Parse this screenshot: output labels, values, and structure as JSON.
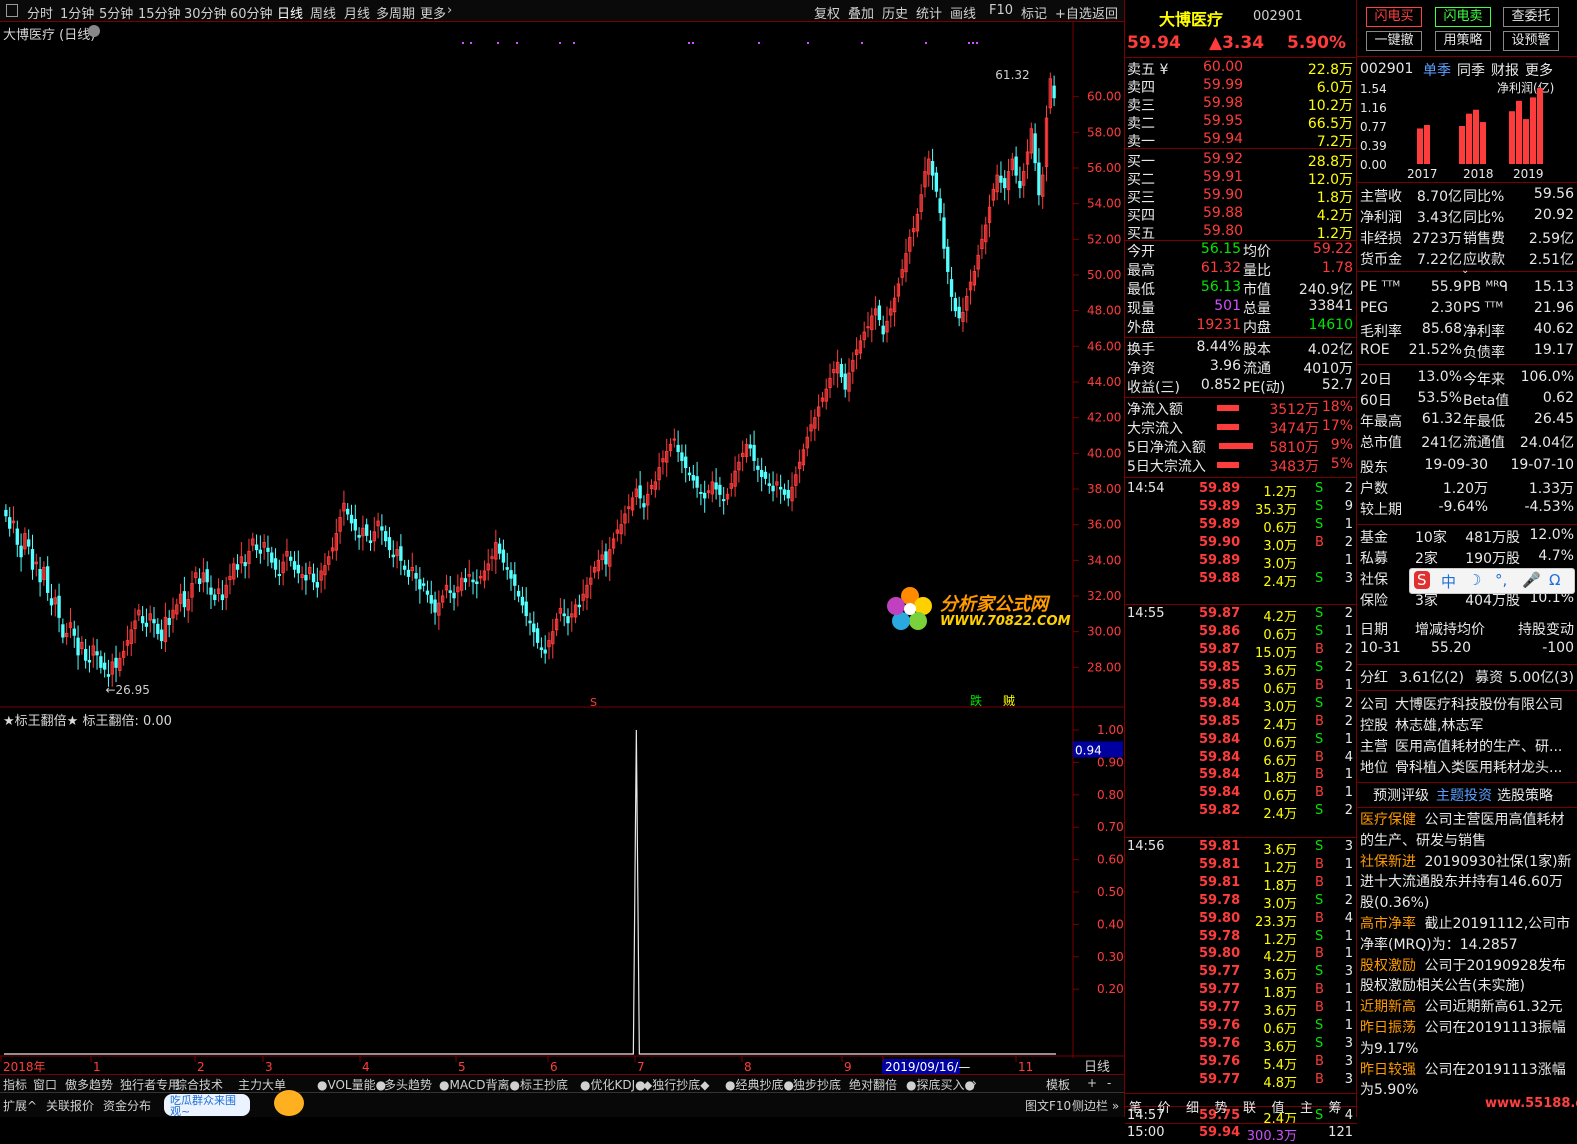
{
  "toolbar": {
    "periods": [
      "分时",
      "1分钟",
      "5分钟",
      "15分钟",
      "30分钟",
      "60分钟",
      "日线",
      "周线",
      "月线",
      "多周期",
      "更多"
    ],
    "tools": [
      "复权",
      "叠加",
      "历史",
      "统计",
      "画线",
      "F10",
      "标记",
      "+自选",
      "返回"
    ]
  },
  "chart_title": "大博医疗 (日线)",
  "indicator_title": "★标王翻倍★ 标王翻倍: 0.00",
  "chart_data": [
    {
      "type": "candlestick",
      "ylim": [
        26,
        62
      ],
      "yticks": [
        "60.00",
        "58.00",
        "56.00",
        "54.00",
        "52.00",
        "50.00",
        "48.00",
        "46.00",
        "44.00",
        "42.00",
        "40.00",
        "38.00",
        "36.00",
        "34.00",
        "32.00",
        "30.00",
        "28.00"
      ],
      "x_labels": [
        "2018年",
        "1",
        "2",
        "3",
        "4",
        "5",
        "6",
        "7",
        "8",
        "9",
        "2019/09/16/—",
        "11"
      ],
      "annotations": {
        "high": "61.32",
        "low": "26.95"
      },
      "closes": [
        36.5,
        35.8,
        36.2,
        34.9,
        34.2,
        35.5,
        34.8,
        33.5,
        33.9,
        32.8,
        33.6,
        32.2,
        31.5,
        31.9,
        30.8,
        29.7,
        29.9,
        30.5,
        29.8,
        28.7,
        29.4,
        28.4,
        28.3,
        29.2,
        28.7,
        28.0,
        27.9,
        27.5,
        28.3,
        28.0,
        28.5,
        28.9,
        29.5,
        30.1,
        30.6,
        31.2,
        30.5,
        30.3,
        31.0,
        30.5,
        29.9,
        29.5,
        30.8,
        30.4,
        31.2,
        31.5,
        32.1,
        31.4,
        31.8,
        32.7,
        33.3,
        32.7,
        33.3,
        32.8,
        32.1,
        31.8,
        32.4,
        31.8,
        32.6,
        33.1,
        33.8,
        33.5,
        34.2,
        33.7,
        34.5,
        35.2,
        34.6,
        34.4,
        35.0,
        34.5,
        33.9,
        33.5,
        33.2,
        33.9,
        34.5,
        34.0,
        33.5,
        33.3,
        33.2,
        32.9,
        33.6,
        32.8,
        32.5,
        33.4,
        33.7,
        34.2,
        34.7,
        35.5,
        36.4,
        37.2,
        36.6,
        36.1,
        35.7,
        35.3,
        35.8,
        35.4,
        35.0,
        35.6,
        36.2,
        35.7,
        35.1,
        34.6,
        34.2,
        34.6,
        34.0,
        33.5,
        33.1,
        33.6,
        33.0,
        32.4,
        32.6,
        32.1,
        31.6,
        31.1,
        31.6,
        32.0,
        32.6,
        32.2,
        31.9,
        32.5,
        33.0,
        32.8,
        33.2,
        32.8,
        32.7,
        33.1,
        33.4,
        33.8,
        34.2,
        35.0,
        34.4,
        33.9,
        33.5,
        33.0,
        32.6,
        32.0,
        31.5,
        30.9,
        30.5,
        30.0,
        29.4,
        29.0,
        28.8,
        29.5,
        30.0,
        30.7,
        31.3,
        30.9,
        30.5,
        31.0,
        31.5,
        31.4,
        32.1,
        32.6,
        33.0,
        33.6,
        34.0,
        34.3,
        33.8,
        34.6,
        35.2,
        35.7,
        36.0,
        36.6,
        37.0,
        37.5,
        38.0,
        37.5,
        37.0,
        37.7,
        38.2,
        38.4,
        39.2,
        39.7,
        40.1,
        40.5,
        40.8,
        40.1,
        39.6,
        39.2,
        38.8,
        38.5,
        38.1,
        37.8,
        37.5,
        37.9,
        38.4,
        38.0,
        37.7,
        37.4,
        37.7,
        38.3,
        39.0,
        39.5,
        40.0,
        40.5,
        40.3,
        39.6,
        39.1,
        38.7,
        38.6,
        38.2,
        37.9,
        38.4,
        38.0,
        37.7,
        37.5,
        38.1,
        38.8,
        39.5,
        40.2,
        40.9,
        41.6,
        42.0,
        42.6,
        43.1,
        43.6,
        44.2,
        44.7,
        45.1,
        44.3,
        43.6,
        44.5,
        45.2,
        45.8,
        46.3,
        46.8,
        47.1,
        47.7,
        48.1,
        47.5,
        46.7,
        47.4,
        48.1,
        48.7,
        49.5,
        50.3,
        51.2,
        52.1,
        52.6,
        53.4,
        54.5,
        55.8,
        56.5,
        55.6,
        54.7,
        53.5,
        51.5,
        50.2,
        48.8,
        48.0,
        47.6,
        47.9,
        48.8,
        49.6,
        50.2,
        51.1,
        52.0,
        52.8,
        53.8,
        54.8,
        55.6,
        55.2,
        54.9,
        55.8,
        56.5,
        55.6,
        54.9,
        55.8,
        56.9,
        58.2,
        56.3,
        54.5,
        55.6,
        58.8,
        61.0,
        59.94
      ]
    },
    {
      "type": "line",
      "title": "★标王翻倍★",
      "ylim": [
        0,
        1
      ],
      "yticks": [
        "1.00",
        "0.90",
        "0.80",
        "0.70",
        "0.60",
        "0.50",
        "0.40",
        "0.30",
        "0.20"
      ],
      "current": "0.94",
      "signals": [
        0,
        0,
        0,
        0,
        0,
        0,
        0,
        0,
        0,
        0,
        1,
        0,
        0,
        0,
        0,
        0,
        0,
        0,
        0,
        0,
        0,
        0,
        0,
        0,
        0,
        0,
        0,
        0,
        0,
        0,
        0,
        0,
        0,
        0,
        0,
        0,
        0,
        0,
        0,
        0,
        0,
        0,
        0,
        0,
        0,
        0,
        0,
        0,
        0,
        0
      ],
      "signal_index": 166
    }
  ],
  "chart_marks": [
    "S",
    "跌",
    "贼"
  ],
  "watermark": {
    "line1": "分析家公式网",
    "line2": "WWW.70822.COM"
  },
  "quote": {
    "name": "大博医疗",
    "code": "002901",
    "price": "59.94",
    "change": "▲3.34",
    "pct": "5.90%",
    "asks": [
      [
        "卖五 ¥",
        "60.00",
        "22.8万"
      ],
      [
        "卖四",
        "59.99",
        "6.0万"
      ],
      [
        "卖三",
        "59.98",
        "10.2万"
      ],
      [
        "卖二",
        "59.95",
        "66.5万"
      ],
      [
        "卖一",
        "59.94",
        "7.2万"
      ]
    ],
    "bids": [
      [
        "买一",
        "59.92",
        "28.8万"
      ],
      [
        "买二",
        "59.91",
        "12.0万"
      ],
      [
        "买三",
        "59.90",
        "1.8万"
      ],
      [
        "买四",
        "59.88",
        "4.2万"
      ],
      [
        "买五",
        "59.80",
        "1.2万"
      ]
    ],
    "stats": [
      [
        "今开",
        "56.15",
        "均价",
        "59.22"
      ],
      [
        "最高",
        "61.32",
        "量比",
        "1.78"
      ],
      [
        "最低",
        "56.13",
        "市值",
        "240.9亿"
      ],
      [
        "现量",
        "501",
        "总量",
        "33841"
      ],
      [
        "外盘",
        "19231",
        "内盘",
        "14610"
      ]
    ],
    "stats2": [
      [
        "换手",
        "8.44%",
        "股本",
        "4.02亿"
      ],
      [
        "净资",
        "3.96",
        "流通",
        "4010万"
      ],
      [
        "收益(三)",
        "0.852",
        "PE(动)",
        "52.7"
      ]
    ],
    "flows": [
      [
        "净流入额",
        "3512万",
        "18%"
      ],
      [
        "大宗流入",
        "3474万",
        "17%"
      ],
      [
        "5日净流入额",
        "5810万",
        "9%"
      ],
      [
        "5日大宗流入",
        "3483万",
        "5%"
      ]
    ]
  },
  "ticks": [
    {
      "time": "14:54",
      "price": "59.89",
      "vol": "1.2万",
      "side": "S",
      "n": "2"
    },
    {
      "time": "",
      "price": "59.89",
      "vol": "35.3万",
      "side": "S",
      "n": "9"
    },
    {
      "time": "",
      "price": "59.89",
      "vol": "0.6万",
      "side": "S",
      "n": "1"
    },
    {
      "time": "",
      "price": "59.90",
      "vol": "3.0万",
      "side": "B",
      "n": "2"
    },
    {
      "time": "",
      "price": "59.89",
      "vol": "3.0万",
      "side": "",
      "n": "1"
    },
    {
      "time": "",
      "price": "59.88",
      "vol": "2.4万",
      "side": "S",
      "n": "3"
    },
    {
      "time": "14:55",
      "price": "59.87",
      "vol": "4.2万",
      "side": "S",
      "n": "2"
    },
    {
      "time": "",
      "price": "59.86",
      "vol": "0.6万",
      "side": "S",
      "n": "1"
    },
    {
      "time": "",
      "price": "59.87",
      "vol": "15.0万",
      "side": "B",
      "n": "2"
    },
    {
      "time": "",
      "price": "59.85",
      "vol": "3.6万",
      "side": "S",
      "n": "2"
    },
    {
      "time": "",
      "price": "59.85",
      "vol": "0.6万",
      "side": "B",
      "n": "1"
    },
    {
      "time": "",
      "price": "59.84",
      "vol": "3.0万",
      "side": "S",
      "n": "2"
    },
    {
      "time": "",
      "price": "59.85",
      "vol": "2.4万",
      "side": "B",
      "n": "2"
    },
    {
      "time": "",
      "price": "59.84",
      "vol": "0.6万",
      "side": "S",
      "n": "1"
    },
    {
      "time": "",
      "price": "59.84",
      "vol": "6.6万",
      "side": "B",
      "n": "4"
    },
    {
      "time": "",
      "price": "59.84",
      "vol": "1.8万",
      "side": "B",
      "n": "1"
    },
    {
      "time": "",
      "price": "59.84",
      "vol": "0.6万",
      "side": "B",
      "n": "1"
    },
    {
      "time": "",
      "price": "59.82",
      "vol": "2.4万",
      "side": "S",
      "n": "2"
    },
    {
      "time": "14:56",
      "price": "59.81",
      "vol": "3.6万",
      "side": "S",
      "n": "3"
    },
    {
      "time": "",
      "price": "59.81",
      "vol": "1.2万",
      "side": "B",
      "n": "1"
    },
    {
      "time": "",
      "price": "59.81",
      "vol": "1.8万",
      "side": "B",
      "n": "1"
    },
    {
      "time": "",
      "price": "59.78",
      "vol": "3.0万",
      "side": "S",
      "n": "2"
    },
    {
      "time": "",
      "price": "59.80",
      "vol": "23.3万",
      "side": "B",
      "n": "4"
    },
    {
      "time": "",
      "price": "59.78",
      "vol": "1.2万",
      "side": "S",
      "n": "1"
    },
    {
      "time": "",
      "price": "59.80",
      "vol": "4.2万",
      "side": "B",
      "n": "1"
    },
    {
      "time": "",
      "price": "59.77",
      "vol": "3.6万",
      "side": "S",
      "n": "3"
    },
    {
      "time": "",
      "price": "59.77",
      "vol": "1.8万",
      "side": "B",
      "n": "1"
    },
    {
      "time": "",
      "price": "59.77",
      "vol": "3.6万",
      "side": "B",
      "n": "1"
    },
    {
      "time": "",
      "price": "59.76",
      "vol": "0.6万",
      "side": "S",
      "n": "1"
    },
    {
      "time": "",
      "price": "59.76",
      "vol": "3.6万",
      "side": "S",
      "n": "3"
    },
    {
      "time": "",
      "price": "59.76",
      "vol": "5.4万",
      "side": "B",
      "n": "3"
    },
    {
      "time": "",
      "price": "59.77",
      "vol": "4.8万",
      "side": "B",
      "n": "3"
    },
    {
      "time": "14:57",
      "price": "59.75",
      "vol": "2.4万",
      "side": "S",
      "n": "4"
    },
    {
      "time": "15:00",
      "price": "59.94",
      "vol": "300.3万",
      "side": "",
      "n": "121"
    }
  ],
  "buttons": {
    "flash_sell": "闪电买",
    "flash_buy": "闪电卖",
    "query": "查委托",
    "cancel": "一键撤",
    "strategy": "用策略",
    "alert": "设预警"
  },
  "fin": {
    "code": "002901",
    "tabs": [
      "单季",
      "同季",
      "财报",
      "更多"
    ],
    "chart_label": "净利润(亿)",
    "yticks": [
      "1.54",
      "1.16",
      "0.77",
      "0.39",
      "0.00"
    ],
    "years": [
      "2017",
      "2018",
      "2019"
    ],
    "bars": [
      0.72,
      0.79,
      0.77,
      1.02,
      1.1,
      0.85,
      1.07,
      1.28,
      0.91,
      1.35,
      1.54
    ],
    "rows": [
      [
        "主营收",
        "8.70亿",
        "同比%",
        "59.56"
      ],
      [
        "净利润",
        "3.43亿",
        "同比%",
        "20.92"
      ],
      [
        "非经损",
        "2723万",
        "销售费",
        "2.59亿"
      ],
      [
        "货币金",
        "7.22亿",
        "应收款",
        "2.51亿"
      ],
      [
        "PE ᵀᵀᴹ",
        "55.9",
        "PB ᴹᴿᑫ",
        "15.13"
      ],
      [
        "PEG",
        "2.30",
        "PS ᵀᵀᴹ",
        "21.96"
      ],
      [
        "毛利率",
        "85.68",
        "净利率",
        "40.62"
      ],
      [
        "ROE",
        "21.52%",
        "负债率",
        "19.17"
      ],
      [
        "20日",
        "13.0%",
        "今年来",
        "106.0%"
      ],
      [
        "60日",
        "53.5%",
        "Beta值",
        "0.62"
      ],
      [
        "年最高",
        "61.32",
        "年最低",
        "26.45"
      ],
      [
        "总市值",
        "241亿",
        "流通值",
        "24.04亿"
      ]
    ],
    "holders": [
      [
        "股东",
        "19-09-30",
        "19-07-10"
      ],
      [
        "户数",
        "1.20万",
        "1.33万"
      ],
      [
        "较上期",
        "-9.64%",
        "-4.53%"
      ]
    ],
    "inst": [
      [
        "基金",
        "10家",
        "481万股",
        "12.0%"
      ],
      [
        "私募",
        "2家",
        "190万股",
        "4.7%"
      ],
      [
        "社保",
        "",
        "",
        ""
      ],
      [
        "保险",
        "3家",
        "404万股",
        "10.1%"
      ]
    ],
    "pledge": [
      [
        "日期",
        "增减持均价",
        "持股变动"
      ],
      [
        "10-31",
        "55.20",
        "-100"
      ]
    ],
    "div": [
      "分红",
      "3.61亿(2)",
      "募资",
      "5.00亿(3)"
    ],
    "company": [
      [
        "公司",
        "大博医疗科技股份有限公司"
      ],
      [
        "控股",
        "林志雄,林志军"
      ],
      [
        "主营",
        "医用高值耗材的生产、研..."
      ],
      [
        "地位",
        "骨科植入类医用耗材龙头..."
      ]
    ],
    "links": [
      "预测评级",
      "主题投资",
      "选股策略"
    ],
    "themes": [
      [
        "医疗保健",
        "公司主营医用高值耗材的生产、研发与销售"
      ],
      [
        "社保新进",
        "20190930社保(1家)新进十大流通股东并持有146.60万股(0.36%)"
      ],
      [
        "高市净率",
        "截止20191112,公司市净率(MRQ)为：14.2857"
      ],
      [
        "股权激励",
        "公司于20190928发布股权激励相关公告(未实施)"
      ],
      [
        "近期新高",
        "公司近期新高61.32元"
      ],
      [
        "昨日振荡",
        "公司在20191113振幅为9.17%"
      ],
      [
        "昨日较强",
        "公司在20191113涨幅为5.90%"
      ]
    ]
  },
  "bottom_tabs": [
    "指标",
    "窗口",
    "傲多趋势",
    "独行者专用",
    "综合技术",
    "主力大单",
    "●VOL量能●",
    "多头趋势",
    "●MACD背离●",
    "标王抄底",
    "●优化KDJ●",
    "◆独行抄底◆",
    "●经典抄底●",
    "独步抄底",
    "绝对翻倍",
    "●探底买入●"
  ],
  "bottom_right": [
    "模板",
    "+",
    "-"
  ],
  "status": [
    "扩展^",
    "关联报价",
    "资金分布"
  ],
  "promo": "吃瓜群众来围观~",
  "status_right": [
    "图文F10",
    "侧边栏 »"
  ],
  "right_tabs": [
    "笔",
    "价",
    "细",
    "势",
    "联",
    "值",
    "主",
    "筹"
  ],
  "period_label": "日线",
  "ime": [
    "S",
    "中",
    "☽",
    "°,",
    "🎤",
    "Ω"
  ],
  "site_watermark": "www.55188.com"
}
